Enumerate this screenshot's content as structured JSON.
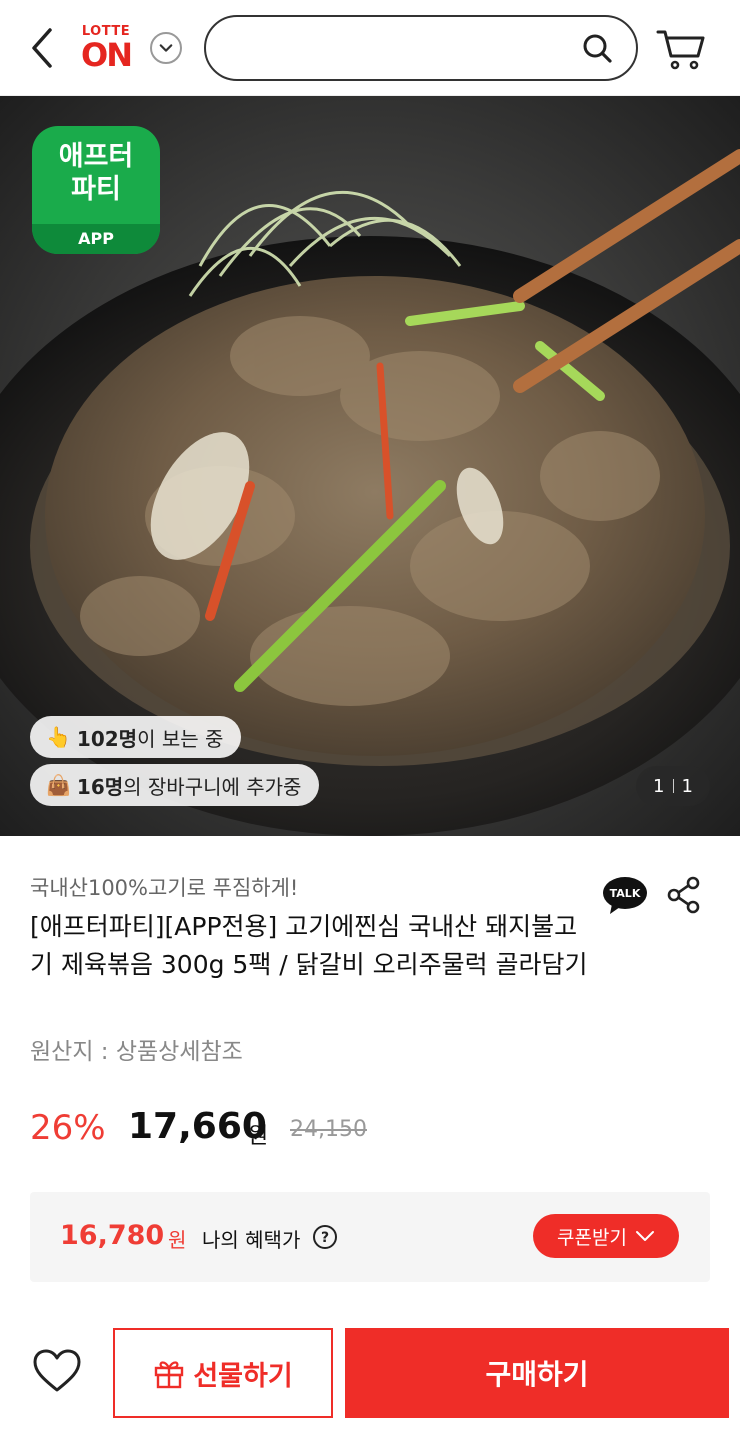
{
  "header": {
    "logo_top": "LOTTE",
    "logo_main": "ON",
    "search_placeholder": "",
    "brand_color": "#e52620"
  },
  "hero": {
    "badge_line1": "애프터",
    "badge_line2": "파티",
    "badge_app": "APP",
    "viewers_emoji": "👆",
    "viewers_count": "102명",
    "viewers_suffix": "이 보는 중",
    "cart_emoji": "👜",
    "cart_count": "16명",
    "cart_suffix": "의 장바구니에 추가중",
    "pager_current": "1",
    "pager_total": "1"
  },
  "product": {
    "subtitle": "국내산100%고기로 푸짐하게!",
    "title": "[애프터파티][APP전용] 고기에찐심 국내산 돼지불고기 제육볶음 300g 5팩 / 닭갈비 오리주물럭 골라담기",
    "origin": "원산지 : 상품상세참조",
    "discount": "26%",
    "price": "17,660",
    "price_unit": "원",
    "original_price": "24,150"
  },
  "benefit": {
    "price": "16,780",
    "unit": "원",
    "label": "나의 혜택가",
    "coupon_label": "쿠폰받기"
  },
  "actions": {
    "gift_label": "선물하기",
    "buy_label": "구매하기",
    "accent": "#ef2d28"
  }
}
